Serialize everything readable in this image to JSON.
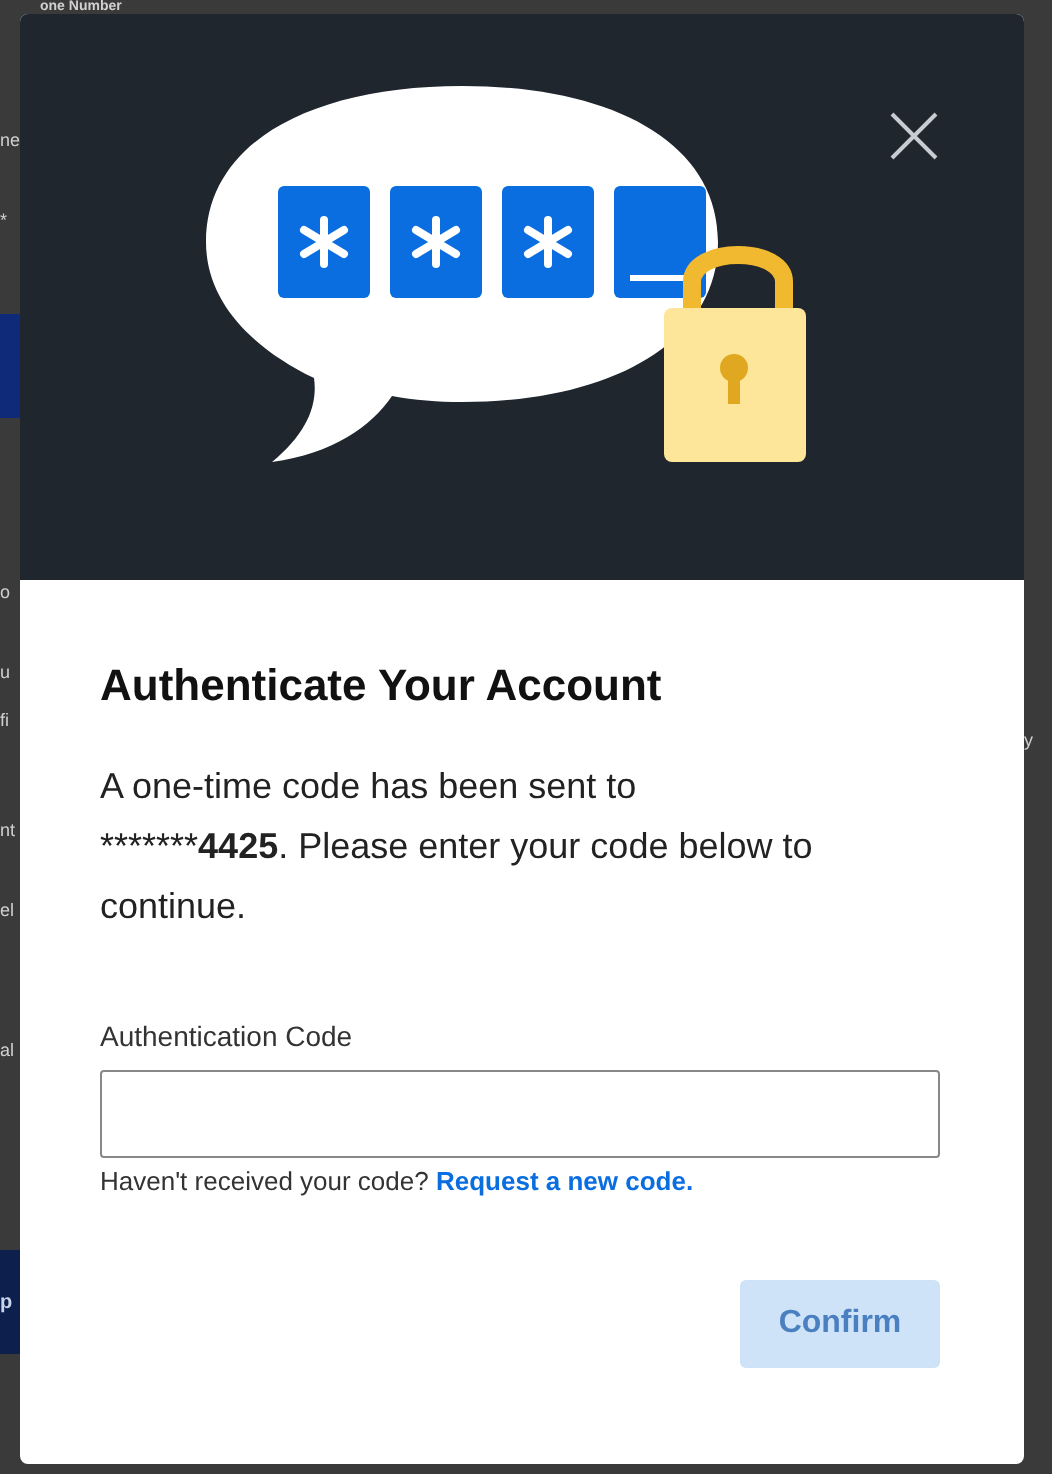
{
  "backdrop": {
    "heading": "one Number",
    "left_items": [
      {
        "kind": "text",
        "label": "ne"
      },
      {
        "kind": "text",
        "label": "*"
      },
      {
        "kind": "button"
      },
      {
        "kind": "text",
        "label": "o"
      },
      {
        "kind": "text",
        "label": "u"
      },
      {
        "kind": "text",
        "label": "fi"
      },
      {
        "kind": "text",
        "label": "nt"
      },
      {
        "kind": "text",
        "label": "el"
      },
      {
        "kind": "text",
        "label": "al"
      },
      {
        "kind": "button",
        "label": "p"
      }
    ],
    "right_items": [
      {
        "kind": "text",
        "label": "y"
      }
    ]
  },
  "dialog": {
    "title": "Authenticate Your Account",
    "message_line1": "A one-time code has been sent to",
    "message_before": "*******",
    "message_number": "4425",
    "message_after": ". Please enter your code below to continue.",
    "field_label": "Authentication Code",
    "help_text": "Haven't received your code?",
    "help_link": "Request a new code.",
    "confirm": {
      "label": "Confirm",
      "disabled": true
    }
  }
}
